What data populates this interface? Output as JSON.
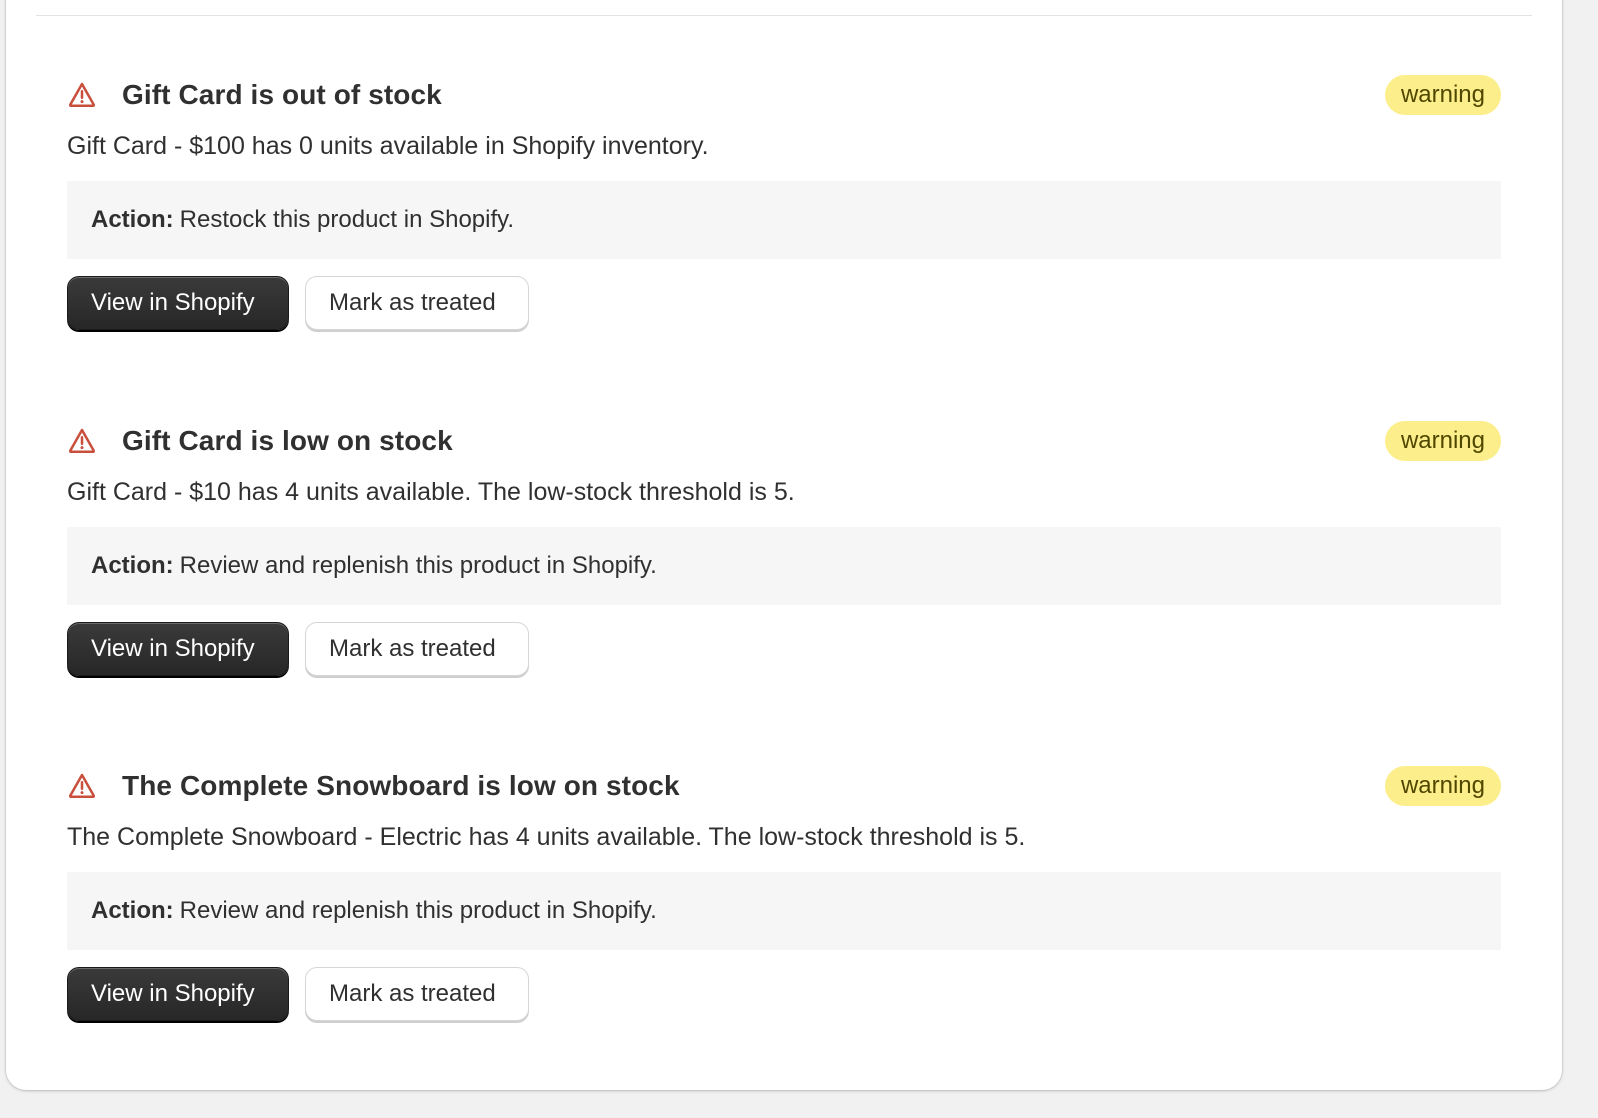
{
  "colors": {
    "badge_bg": "#fcee8b",
    "icon": "#c94f3d",
    "primary_button_bg": "#303030"
  },
  "alerts": [
    {
      "icon": "warning-triangle-icon",
      "title": "Gift Card is out of stock",
      "badge": "warning",
      "description": "Gift Card - $100 has 0 units available in Shopify inventory.",
      "action_label": "Action:",
      "action_text": "Restock this product in Shopify.",
      "primary_label": "View in Shopify",
      "secondary_label": "Mark as treated"
    },
    {
      "icon": "warning-triangle-icon",
      "title": "Gift Card is low on stock",
      "badge": "warning",
      "description": "Gift Card - $10 has 4 units available. The low-stock threshold is 5.",
      "action_label": "Action:",
      "action_text": "Review and replenish this product in Shopify.",
      "primary_label": "View in Shopify",
      "secondary_label": "Mark as treated"
    },
    {
      "icon": "warning-triangle-icon",
      "title": "The Complete Snowboard is low on stock",
      "badge": "warning",
      "description": "The Complete Snowboard - Electric has 4 units available. The low-stock threshold is 5.",
      "action_label": "Action:",
      "action_text": "Review and replenish this product in Shopify.",
      "primary_label": "View in Shopify",
      "secondary_label": "Mark as treated"
    }
  ]
}
